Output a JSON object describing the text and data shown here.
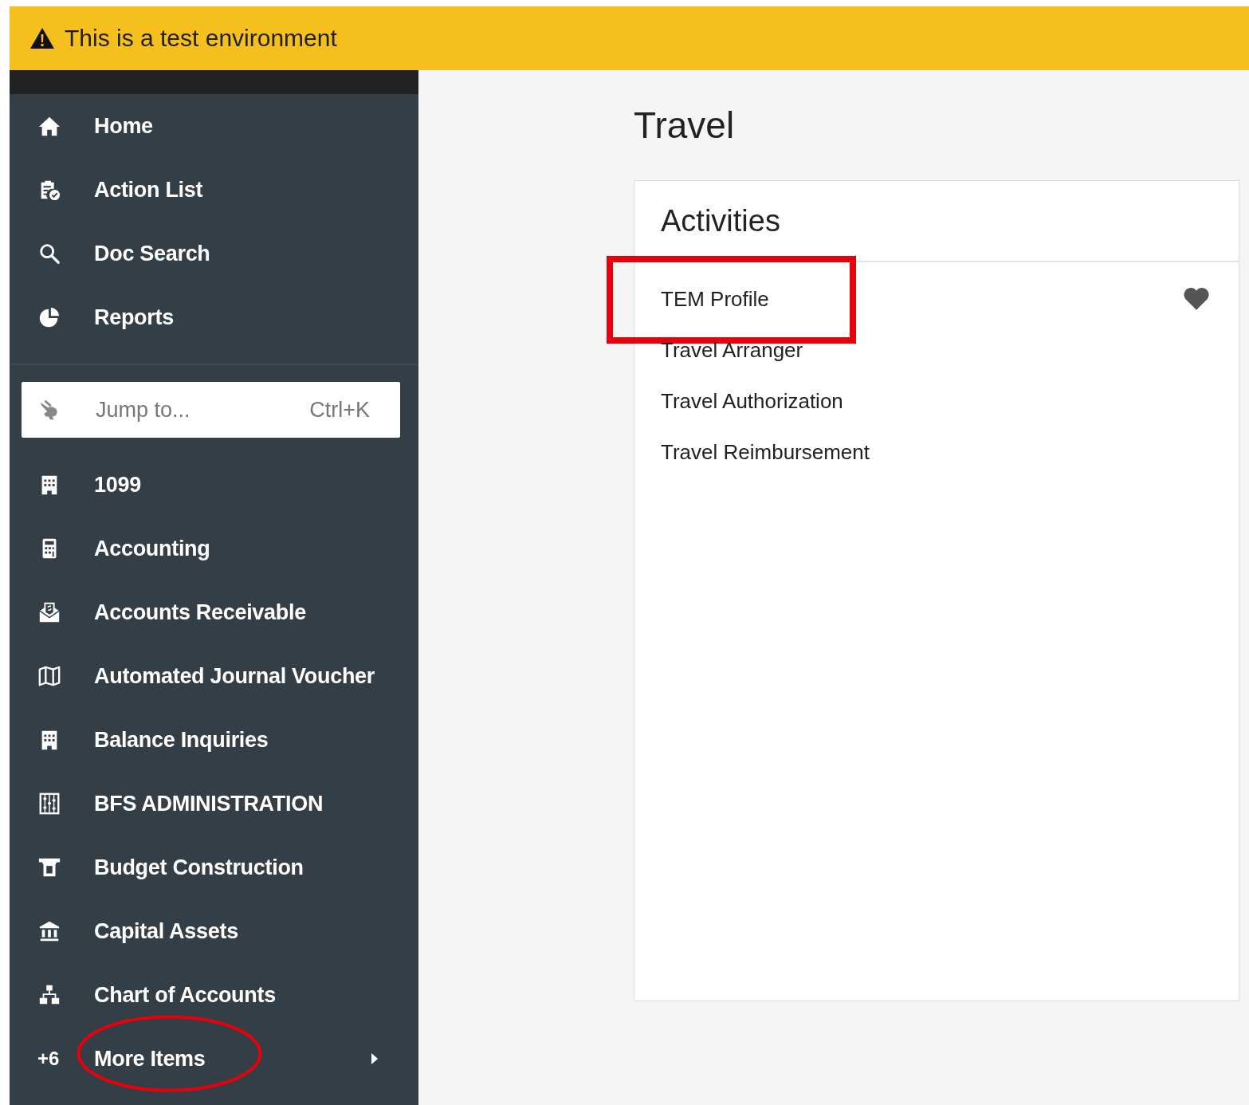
{
  "banner": {
    "text": "This is a test environment"
  },
  "sidebar": {
    "top_items": [
      {
        "label": "Home"
      },
      {
        "label": "Action List"
      },
      {
        "label": "Doc Search"
      },
      {
        "label": "Reports"
      }
    ],
    "jump": {
      "placeholder": "Jump to...",
      "shortcut": "Ctrl+K"
    },
    "modules": [
      {
        "label": "1099"
      },
      {
        "label": "Accounting"
      },
      {
        "label": "Accounts Receivable"
      },
      {
        "label": "Automated Journal Voucher"
      },
      {
        "label": "Balance Inquiries"
      },
      {
        "label": "BFS ADMINISTRATION"
      },
      {
        "label": "Budget Construction"
      },
      {
        "label": "Capital Assets"
      },
      {
        "label": "Chart of Accounts"
      }
    ],
    "more_items": {
      "count": "+6",
      "label": "More Items",
      "highlighted": true
    }
  },
  "page": {
    "title": "Travel",
    "card": {
      "title": "Activities",
      "items": [
        {
          "label": "TEM Profile",
          "favorite": true,
          "highlighted": true
        },
        {
          "label": "Travel Arranger",
          "favorite": false,
          "highlighted": false
        },
        {
          "label": "Travel Authorization",
          "favorite": false,
          "highlighted": false
        },
        {
          "label": "Travel Reimbursement",
          "favorite": false,
          "highlighted": false
        }
      ]
    }
  }
}
